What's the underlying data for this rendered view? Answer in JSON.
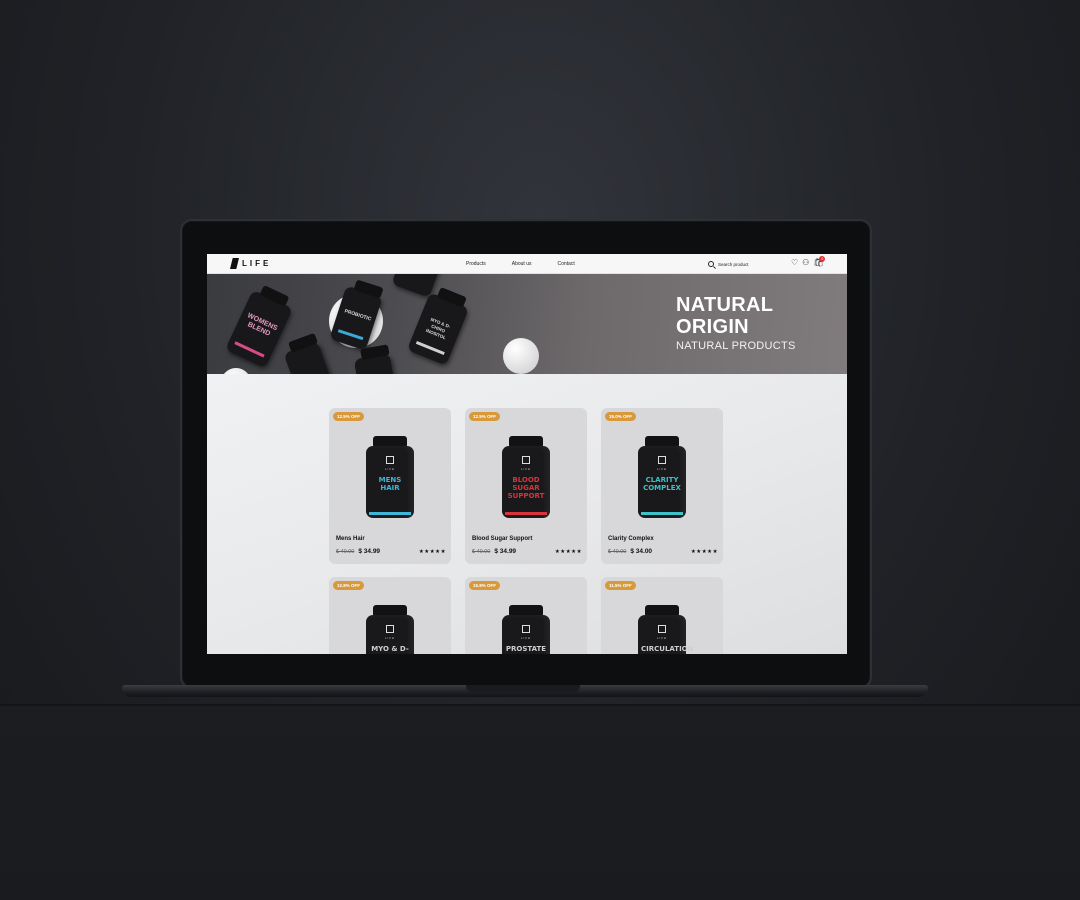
{
  "brand": {
    "logo_text": "LIFE"
  },
  "nav": {
    "links": [
      "Products",
      "About us",
      "Contact"
    ],
    "search_placeholder": "Search product",
    "cart_count": "0"
  },
  "hero": {
    "title_line1": "NATURAL",
    "title_line2": "ORIGIN",
    "subtitle": "NATURAL PRODUCTS",
    "bottle_labels": [
      "WOMENS BLEND",
      "PROBIOTIC",
      "MYO & D-CHIRO INOSITOL"
    ]
  },
  "products": [
    {
      "badge": "12.5% OFF",
      "bottle_label": "MENS HAIR",
      "accent": "#3fb6d8",
      "name": "Mens Hair",
      "old_price": "$ 40.00",
      "price": "$ 34.99",
      "stars": "★★★★★"
    },
    {
      "badge": "12.5% OFF",
      "bottle_label": "BLOOD SUGAR SUPPORT",
      "accent": "#d8343b",
      "name": "Blood Sugar Support",
      "old_price": "$ 40.00",
      "price": "$ 34.99",
      "stars": "★★★★★"
    },
    {
      "badge": "15.0% OFF",
      "bottle_label": "CLARITY COMPLEX",
      "accent": "#3ec1c8",
      "name": "Clarity Complex",
      "old_price": "$ 40.00",
      "price": "$ 34.00",
      "stars": "★★★★★"
    },
    {
      "badge": "12.8% OFF",
      "bottle_label": "MYO & D-CHIRO",
      "accent": "#cfcfd2",
      "name": "",
      "old_price": "",
      "price": "",
      "stars": ""
    },
    {
      "badge": "15.8% OFF",
      "bottle_label": "PROSTATE",
      "accent": "#cfcfd2",
      "name": "",
      "old_price": "",
      "price": "",
      "stars": ""
    },
    {
      "badge": "11.5% OFF",
      "bottle_label": "CIRCULATION",
      "accent": "#cfcfd2",
      "name": "",
      "old_price": "",
      "price": "",
      "stars": ""
    }
  ]
}
